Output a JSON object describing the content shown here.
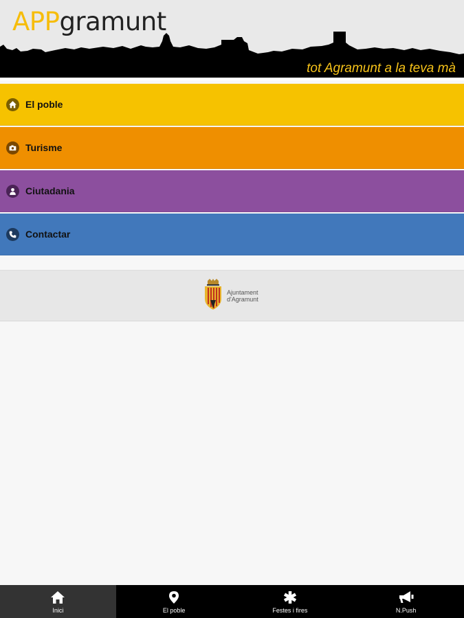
{
  "header": {
    "logo_prefix": "APP",
    "logo_rest": "gramunt",
    "tagline": "tot Agramunt a la teva mà"
  },
  "menu": {
    "items": [
      {
        "label": "El poble",
        "color": "#f6c200",
        "icon": "home-icon"
      },
      {
        "label": "Turisme",
        "color": "#ef8f00",
        "icon": "camera-icon"
      },
      {
        "label": "Ciutadania",
        "color": "#8c4f9e",
        "icon": "person-icon"
      },
      {
        "label": "Contactar",
        "color": "#4178bb",
        "icon": "phone-icon"
      }
    ]
  },
  "sponsor": {
    "line1": "Ajuntament",
    "line2": "d'Agramunt"
  },
  "tabbar": {
    "tabs": [
      {
        "label": "Inici",
        "icon": "home-icon",
        "active": true
      },
      {
        "label": "El poble",
        "icon": "map-pin-icon",
        "active": false
      },
      {
        "label": "Festes i fires",
        "icon": "asterisk-icon",
        "active": false
      },
      {
        "label": "N.Push",
        "icon": "megaphone-icon",
        "active": false
      }
    ]
  }
}
